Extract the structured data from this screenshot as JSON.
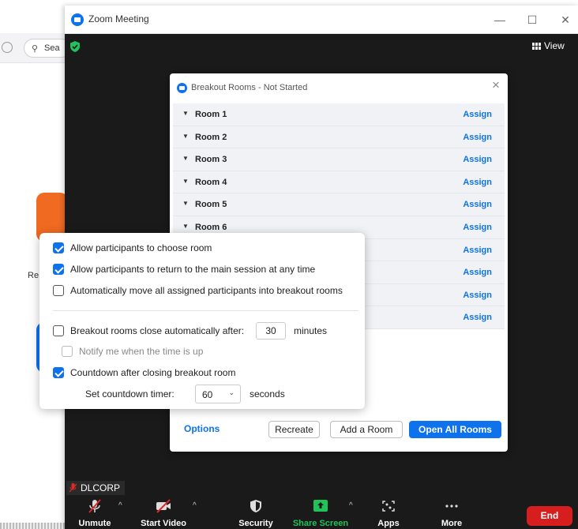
{
  "background_app": {
    "search_text": "Sea",
    "side_label": "Re"
  },
  "window": {
    "title": "Zoom Meeting",
    "view_label": "View"
  },
  "dialog": {
    "title": "Breakout Rooms - Not Started",
    "rooms": [
      {
        "name": "Room 1",
        "action": "Assign"
      },
      {
        "name": "Room 2",
        "action": "Assign"
      },
      {
        "name": "Room 3",
        "action": "Assign"
      },
      {
        "name": "Room 4",
        "action": "Assign"
      },
      {
        "name": "Room 5",
        "action": "Assign"
      },
      {
        "name": "Room 6",
        "action": "Assign"
      },
      {
        "name": "",
        "action": "Assign"
      },
      {
        "name": "",
        "action": "Assign"
      },
      {
        "name": "",
        "action": "Assign"
      },
      {
        "name": "",
        "action": "Assign"
      }
    ],
    "options_label": "Options",
    "recreate_label": "Recreate",
    "add_room_label": "Add a Room",
    "open_all_label": "Open All Rooms"
  },
  "options": {
    "allow_choose": {
      "label": "Allow participants to choose room",
      "checked": true
    },
    "allow_return": {
      "label": "Allow participants to return to the main session at any time",
      "checked": true
    },
    "auto_move": {
      "label": "Automatically move all assigned participants into breakout rooms",
      "checked": false
    },
    "auto_close": {
      "label": "Breakout rooms close automatically after:",
      "checked": false,
      "minutes": "30",
      "minutes_unit": "minutes"
    },
    "notify": {
      "label": "Notify me when the time is up",
      "checked": false,
      "disabled": true
    },
    "countdown": {
      "label": "Countdown after closing breakout room",
      "checked": true
    },
    "countdown_timer": {
      "label": "Set countdown timer:",
      "value": "60",
      "unit": "seconds"
    }
  },
  "participant": {
    "name": "DLCORP"
  },
  "toolbar": {
    "unmute": "Unmute",
    "start_video": "Start Video",
    "security": "Security",
    "share_screen": "Share Screen",
    "apps": "Apps",
    "more": "More",
    "end": "End"
  },
  "colors": {
    "accent": "#0e72ed",
    "share_green": "#22c25a",
    "end_red": "#d71e1e"
  }
}
